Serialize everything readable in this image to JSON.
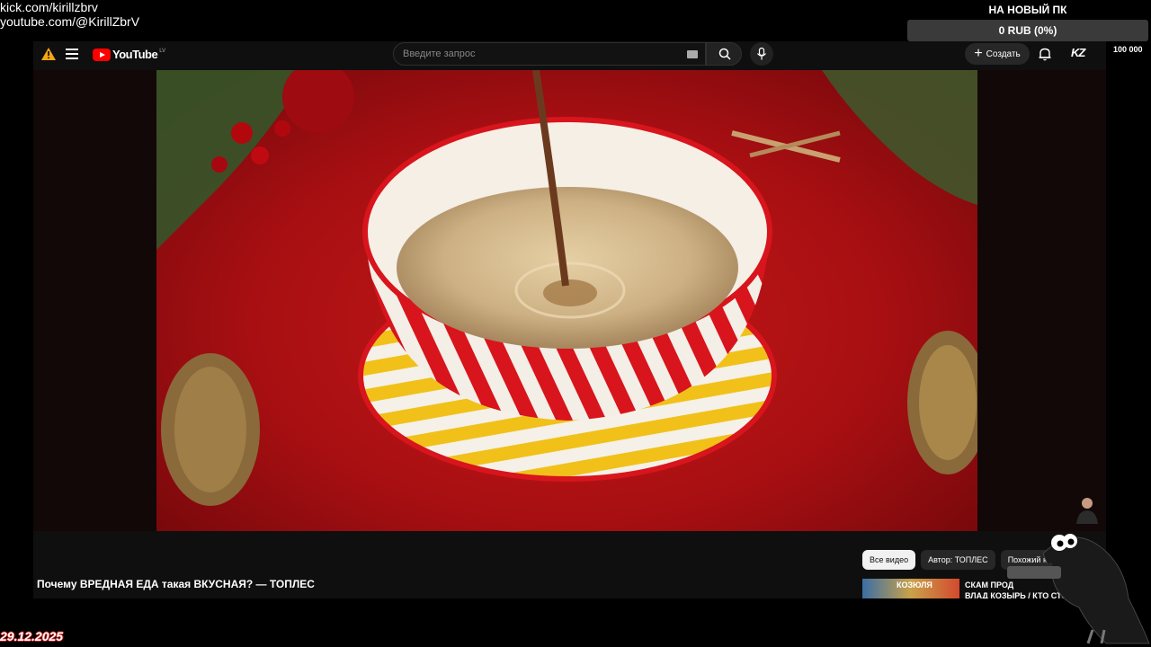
{
  "stream_overlay": {
    "links": [
      "kick.com/kirillzbrv",
      "youtube.com/@KirillZbrV"
    ],
    "date": "29.12.2025",
    "donation_goal": {
      "title": "НА НОВЫЙ ПК",
      "progress_text": "0 RUB (0%)",
      "progress_percent": 0,
      "min_label": "0",
      "max_label": "100 000"
    }
  },
  "youtube": {
    "logo_text": "YouTube",
    "country_code": "LV",
    "search": {
      "placeholder": "Введите запрос",
      "value": ""
    },
    "create_label": "Создать",
    "avatar_text": "KZ",
    "video_title": "Почему ВРЕДНАЯ ЕДА такая ВКУСНАЯ? — ТОПЛЕС",
    "chips": [
      "Все видео",
      "Автор: ТОПЛЕС",
      "Похожий к"
    ],
    "recommendation": {
      "thumb_text": "КОЗЮЛЯ",
      "title_line1": "СКАМ ПРОД",
      "title_line2": "ВЛАД КОЗЫРЬ / КТО СТОИ"
    }
  },
  "colors": {
    "brand_red": "#ff0000",
    "background": "#0f0f0f",
    "chip_active": "#f1f1f1"
  }
}
